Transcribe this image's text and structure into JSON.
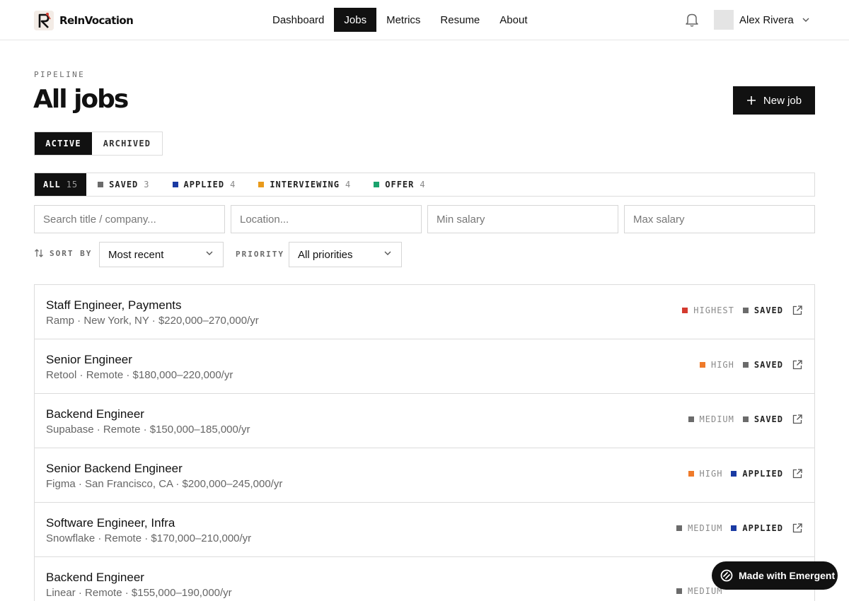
{
  "app": {
    "name": "ReInVocation"
  },
  "nav": {
    "items": [
      {
        "label": "Dashboard",
        "active": false
      },
      {
        "label": "Jobs",
        "active": true
      },
      {
        "label": "Metrics",
        "active": false
      },
      {
        "label": "Resume",
        "active": false
      },
      {
        "label": "About",
        "active": false
      }
    ]
  },
  "user": {
    "name": "Alex Rivera"
  },
  "header": {
    "eyebrow": "PIPELINE",
    "title": "All jobs",
    "new_job_label": "New job"
  },
  "view_toggle": {
    "active_label": "ACTIVE",
    "archived_label": "ARCHIVED",
    "selected": "ACTIVE"
  },
  "status_filters": [
    {
      "label": "ALL",
      "count": "15",
      "active": true,
      "color": ""
    },
    {
      "label": "SAVED",
      "count": "3",
      "active": false,
      "color": "#6b6b6b"
    },
    {
      "label": "APPLIED",
      "count": "4",
      "active": false,
      "color": "#1a3aa3"
    },
    {
      "label": "INTERVIEWING",
      "count": "4",
      "active": false,
      "color": "#e99a1b"
    },
    {
      "label": "OFFER",
      "count": "4",
      "active": false,
      "color": "#1aa36d"
    }
  ],
  "filters": {
    "search_placeholder": "Search title / company...",
    "location_placeholder": "Location...",
    "min_salary_placeholder": "Min salary",
    "max_salary_placeholder": "Max salary",
    "sort_label": "SORT BY",
    "sort_value": "Most recent",
    "priority_label": "PRIORITY",
    "priority_value": "All priorities"
  },
  "colors": {
    "priority_highest": "#d43a2f",
    "priority_high": "#ef7a2a",
    "priority_medium": "#6b6b6b",
    "status_saved": "#6b6b6b",
    "status_applied": "#1a3aa3"
  },
  "jobs": [
    {
      "title": "Staff Engineer, Payments",
      "meta": "Ramp · New York, NY · $220,000–270,000/yr",
      "priority": "HIGHEST",
      "priority_color": "#d43a2f",
      "status": "SAVED",
      "status_color": "#6b6b6b"
    },
    {
      "title": "Senior Engineer",
      "meta": "Retool · Remote · $180,000–220,000/yr",
      "priority": "HIGH",
      "priority_color": "#ef7a2a",
      "status": "SAVED",
      "status_color": "#6b6b6b"
    },
    {
      "title": "Backend Engineer",
      "meta": "Supabase · Remote · $150,000–185,000/yr",
      "priority": "MEDIUM",
      "priority_color": "#6b6b6b",
      "status": "SAVED",
      "status_color": "#6b6b6b"
    },
    {
      "title": "Senior Backend Engineer",
      "meta": "Figma · San Francisco, CA · $200,000–245,000/yr",
      "priority": "HIGH",
      "priority_color": "#ef7a2a",
      "status": "APPLIED",
      "status_color": "#1a3aa3"
    },
    {
      "title": "Software Engineer, Infra",
      "meta": "Snowflake · Remote · $170,000–210,000/yr",
      "priority": "MEDIUM",
      "priority_color": "#6b6b6b",
      "status": "APPLIED",
      "status_color": "#1a3aa3"
    },
    {
      "title": "Backend Engineer",
      "meta": "Linear · Remote · $155,000–190,000/yr",
      "priority": "MEDIUM",
      "priority_color": "#6b6b6b",
      "status": "",
      "status_color": ""
    }
  ],
  "badge": {
    "label": "Made with Emergent"
  }
}
